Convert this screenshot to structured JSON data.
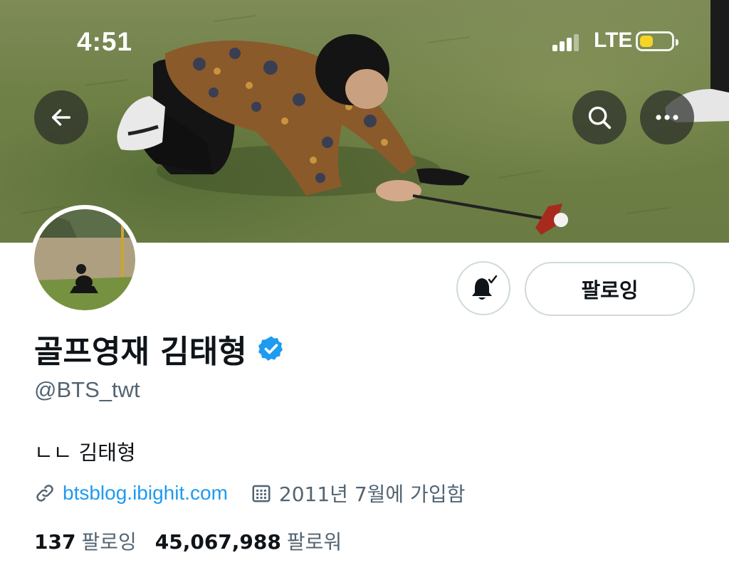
{
  "status_bar": {
    "time": "4:51",
    "network": "LTE",
    "battery_level": 0.5,
    "battery_color": "#f5d426"
  },
  "header": {
    "back_icon": "arrow-left-icon",
    "search_icon": "search-icon",
    "more_icon": "more-horizontal-icon"
  },
  "profile": {
    "display_name": "골프영재 김태형",
    "verified_icon": "verified-badge-icon",
    "verified_color": "#1d9bf0",
    "handle": "@BTS_twt",
    "bio": "ㄴㄴ 김태형",
    "link_icon": "link-icon",
    "link": "btsblog.ibighit.com",
    "calendar_icon": "calendar-icon",
    "joined": "2011년 7월에 가입함",
    "following_count": "137",
    "following_label": "팔로잉",
    "followers_count": "45,067,988",
    "followers_label": "팔로워"
  },
  "actions": {
    "notify_icon": "bell-check-icon",
    "follow_label": "팔로잉"
  }
}
